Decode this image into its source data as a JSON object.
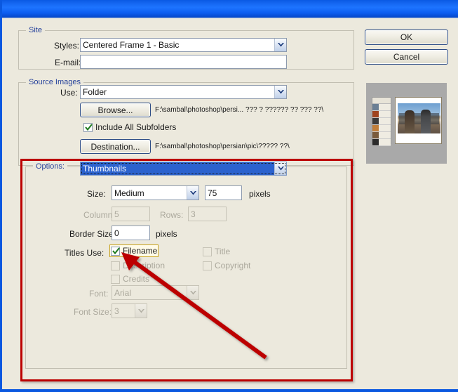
{
  "window": {
    "title": "",
    "title_bar_color": "#1466F0",
    "background_color": "#ECE9DD"
  },
  "buttons": {
    "ok": "OK",
    "cancel": "Cancel"
  },
  "site": {
    "group_label": "Site",
    "styles_label": "Styles:",
    "styles_value": "Centered Frame 1 - Basic",
    "email_label": "E-mail:",
    "email_value": "",
    "email_placeholder": ""
  },
  "source_images": {
    "group_label": "Source Images",
    "use_label": "Use:",
    "use_value": "Folder",
    "browse_button": "Browse...",
    "browse_path": "F:\\sambal\\photoshop\\persi... ??? ? ?????? ?? ??? ??\\",
    "include_subfolders_label": "Include All Subfolders",
    "include_subfolders_checked": true,
    "destination_button": "Destination...",
    "destination_path": "F:\\sambal\\photoshop\\persian\\pic\\????? ??\\"
  },
  "options": {
    "group_label": "Options:",
    "selected_panel": "Thumbnails",
    "size_label": "Size:",
    "size_value": "Medium",
    "size_pixels_value": "75",
    "size_pixels_unit": "pixels",
    "columns_label": "Columns:",
    "columns_value": "5",
    "columns_enabled": false,
    "rows_label": "Rows:",
    "rows_value": "3",
    "rows_enabled": false,
    "border_size_label": "Border Size:",
    "border_size_value": "0",
    "border_size_unit": "pixels",
    "titles_use_label": "Titles Use:",
    "checkboxes": {
      "filename": {
        "label": "Filename",
        "checked": true,
        "enabled": true,
        "focused": true
      },
      "title": {
        "label": "Title",
        "checked": false,
        "enabled": false
      },
      "description": {
        "label": "Description",
        "checked": false,
        "enabled": false
      },
      "copyright": {
        "label": "Copyright",
        "checked": false,
        "enabled": false
      },
      "credits": {
        "label": "Credits",
        "checked": false,
        "enabled": false
      }
    },
    "font_label": "Font:",
    "font_value": "Arial",
    "font_enabled": false,
    "font_size_label": "Font Size:",
    "font_size_value": "3",
    "font_size_enabled": false
  },
  "annotation": {
    "highlight_color": "#BC0000",
    "arrow_color": "#BC0000",
    "target": "filename-checkbox"
  }
}
